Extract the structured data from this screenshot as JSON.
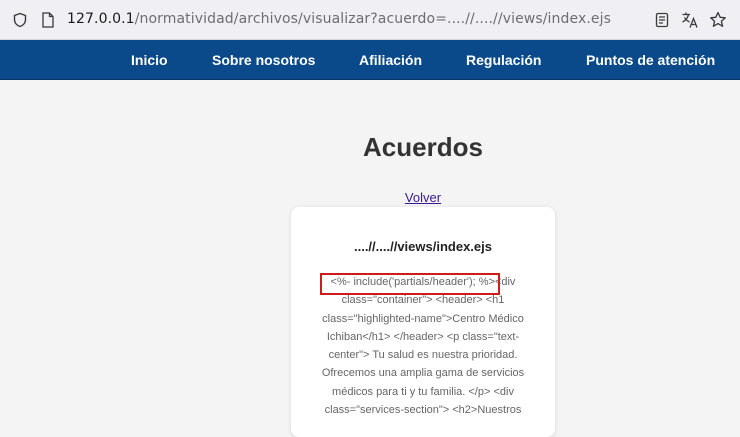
{
  "browser": {
    "url_host": "127.0.0.1",
    "url_path": "/normatividad/archivos/visualizar?acuerdo=....//....//views/index.ejs",
    "icons": [
      "shield-icon",
      "page-icon",
      "reader-view-icon",
      "translate-icon",
      "bookmark-star-icon"
    ]
  },
  "nav": {
    "items": [
      "Inicio",
      "Sobre nosotros",
      "Afiliación",
      "Regulación",
      "Puntos de atención"
    ],
    "background": "#0b4a8a"
  },
  "main": {
    "title": "Acuerdos",
    "back_link": "Volver",
    "card": {
      "filename": "....//....//views/index.ejs",
      "content": "<%- include('partials/header'); %><div class=\"container\"> <header> <h1 class=\"highlighted-name\">Centro Médico Ichiban</h1> </header> <p class=\"text-center\"> Tu salud es nuestra prioridad. Ofrecemos una amplia gama de servicios médicos para ti y tu familia. </p> <div class=\"services-section\"> <h2>Nuestros"
    },
    "highlight_color": "#d11a1a"
  }
}
